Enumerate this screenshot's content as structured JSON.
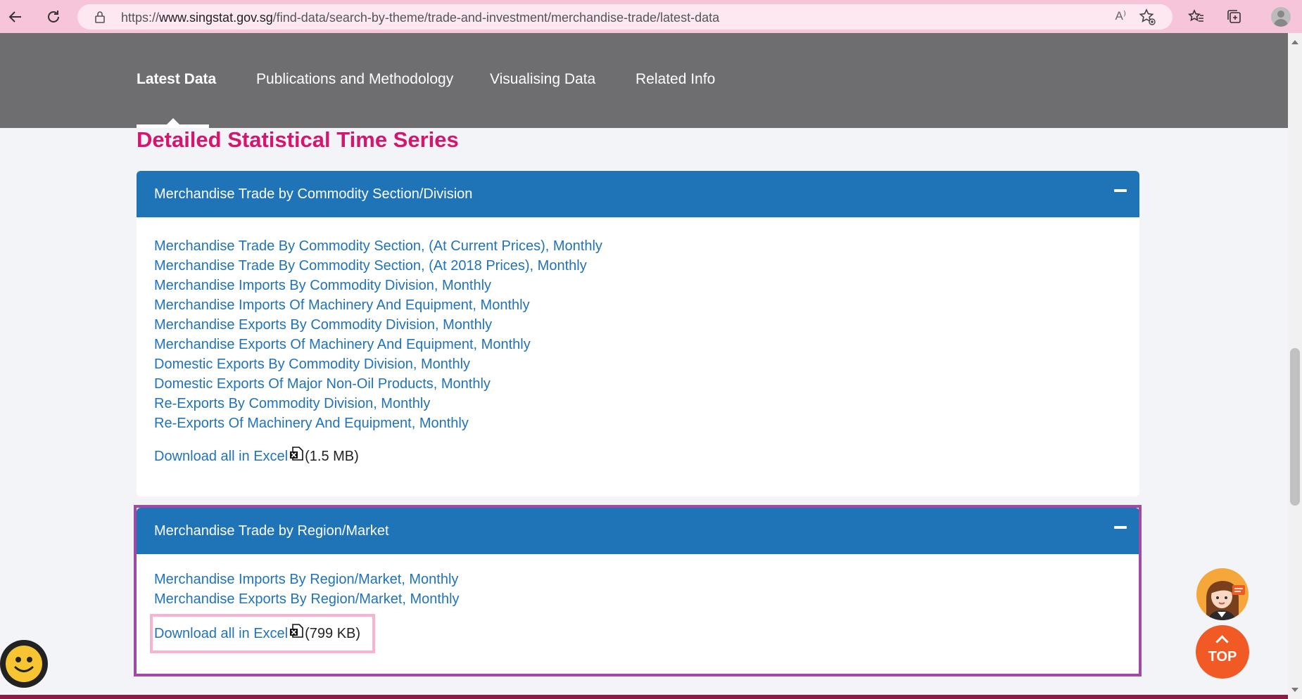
{
  "browser": {
    "url_scheme": "https://",
    "url_host": "www.singstat.gov.sg",
    "url_path": "/find-data/search-by-theme/trade-and-investment/merchandise-trade/latest-data",
    "read_aloud_label": "A⁾"
  },
  "nav": {
    "tabs": [
      {
        "label": "Latest Data",
        "active": true
      },
      {
        "label": "Publications and Methodology",
        "active": false
      },
      {
        "label": "Visualising Data",
        "active": false
      },
      {
        "label": "Related Info",
        "active": false
      }
    ]
  },
  "main": {
    "section_title": "Detailed Statistical Time Series",
    "panels": [
      {
        "title": "Merchandise Trade by Commodity Section/Division",
        "expanded": true,
        "links": [
          "Merchandise Trade By Commodity Section, (At Current Prices), Monthly",
          "Merchandise Trade By Commodity Section, (At 2018 Prices), Monthly",
          "Merchandise Imports By Commodity Division, Monthly",
          "Merchandise Imports Of Machinery And Equipment, Monthly",
          "Merchandise Exports By Commodity Division, Monthly",
          "Merchandise Exports Of Machinery And Equipment, Monthly",
          "Domestic Exports By Commodity Division, Monthly",
          "Domestic Exports Of Major Non-Oil Products, Monthly",
          "Re-Exports By Commodity Division, Monthly",
          "Re-Exports Of Machinery And Equipment, Monthly"
        ],
        "download_label": "Download all in Excel",
        "download_size": "(1.5 MB)"
      },
      {
        "title": "Merchandise Trade by Region/Market",
        "expanded": true,
        "links": [
          "Merchandise Imports By Region/Market, Monthly",
          "Merchandise Exports By Region/Market, Monthly"
        ],
        "download_label": "Download all in Excel",
        "download_size": "(799 KB)"
      }
    ]
  },
  "widgets": {
    "top_button_label": "TOP"
  },
  "colors": {
    "toolbar": "#f7c5da",
    "nav_band": "#6e6e70",
    "section_title": "#d6156e",
    "panel_header": "#1f73b7",
    "link": "#1f73b7",
    "top_button": "#f15a24"
  }
}
